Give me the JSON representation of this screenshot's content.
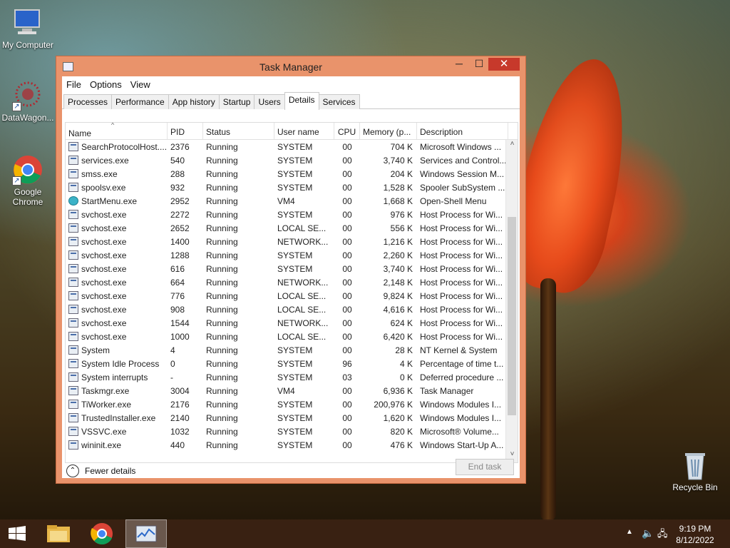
{
  "desktop": {
    "icons": [
      {
        "label": "My Computer",
        "icon": "computer-icon"
      },
      {
        "label": "DataWagon...",
        "icon": "datawagon-icon"
      },
      {
        "label": "Google Chrome",
        "icon": "chrome-icon"
      },
      {
        "label": "Recycle Bin",
        "icon": "recycle-bin-icon"
      }
    ]
  },
  "window": {
    "title": "Task Manager",
    "controls": {
      "minimize": "─",
      "maximize": "☐",
      "close": "✕"
    },
    "menu": [
      "File",
      "Options",
      "View"
    ],
    "tabs": [
      "Processes",
      "Performance",
      "App history",
      "Startup",
      "Users",
      "Details",
      "Services"
    ],
    "active_tab": "Details",
    "columns": [
      "Name",
      "PID",
      "Status",
      "User name",
      "CPU",
      "Memory (p...",
      "Description"
    ],
    "rows": [
      {
        "name": "SearchProtocolHost....",
        "pid": "2376",
        "status": "Running",
        "user": "SYSTEM",
        "cpu": "00",
        "mem": "704 K",
        "desc": "Microsoft Windows ..."
      },
      {
        "name": "services.exe",
        "pid": "540",
        "status": "Running",
        "user": "SYSTEM",
        "cpu": "00",
        "mem": "3,740 K",
        "desc": "Services and Control..."
      },
      {
        "name": "smss.exe",
        "pid": "288",
        "status": "Running",
        "user": "SYSTEM",
        "cpu": "00",
        "mem": "204 K",
        "desc": "Windows Session M..."
      },
      {
        "name": "spoolsv.exe",
        "pid": "932",
        "status": "Running",
        "user": "SYSTEM",
        "cpu": "00",
        "mem": "1,528 K",
        "desc": "Spooler SubSystem ..."
      },
      {
        "name": "StartMenu.exe",
        "pid": "2952",
        "status": "Running",
        "user": "VM4",
        "cpu": "00",
        "mem": "1,668 K",
        "desc": "Open-Shell Menu"
      },
      {
        "name": "svchost.exe",
        "pid": "2272",
        "status": "Running",
        "user": "SYSTEM",
        "cpu": "00",
        "mem": "976 K",
        "desc": "Host Process for Wi..."
      },
      {
        "name": "svchost.exe",
        "pid": "2652",
        "status": "Running",
        "user": "LOCAL SE...",
        "cpu": "00",
        "mem": "556 K",
        "desc": "Host Process for Wi..."
      },
      {
        "name": "svchost.exe",
        "pid": "1400",
        "status": "Running",
        "user": "NETWORK...",
        "cpu": "00",
        "mem": "1,216 K",
        "desc": "Host Process for Wi..."
      },
      {
        "name": "svchost.exe",
        "pid": "1288",
        "status": "Running",
        "user": "SYSTEM",
        "cpu": "00",
        "mem": "2,260 K",
        "desc": "Host Process for Wi..."
      },
      {
        "name": "svchost.exe",
        "pid": "616",
        "status": "Running",
        "user": "SYSTEM",
        "cpu": "00",
        "mem": "3,740 K",
        "desc": "Host Process for Wi..."
      },
      {
        "name": "svchost.exe",
        "pid": "664",
        "status": "Running",
        "user": "NETWORK...",
        "cpu": "00",
        "mem": "2,148 K",
        "desc": "Host Process for Wi..."
      },
      {
        "name": "svchost.exe",
        "pid": "776",
        "status": "Running",
        "user": "LOCAL SE...",
        "cpu": "00",
        "mem": "9,824 K",
        "desc": "Host Process for Wi..."
      },
      {
        "name": "svchost.exe",
        "pid": "908",
        "status": "Running",
        "user": "LOCAL SE...",
        "cpu": "00",
        "mem": "4,616 K",
        "desc": "Host Process for Wi..."
      },
      {
        "name": "svchost.exe",
        "pid": "1544",
        "status": "Running",
        "user": "NETWORK...",
        "cpu": "00",
        "mem": "624 K",
        "desc": "Host Process for Wi..."
      },
      {
        "name": "svchost.exe",
        "pid": "1000",
        "status": "Running",
        "user": "LOCAL SE...",
        "cpu": "00",
        "mem": "6,420 K",
        "desc": "Host Process for Wi..."
      },
      {
        "name": "System",
        "pid": "4",
        "status": "Running",
        "user": "SYSTEM",
        "cpu": "00",
        "mem": "28 K",
        "desc": "NT Kernel & System"
      },
      {
        "name": "System Idle Process",
        "pid": "0",
        "status": "Running",
        "user": "SYSTEM",
        "cpu": "96",
        "mem": "4 K",
        "desc": "Percentage of time t..."
      },
      {
        "name": "System interrupts",
        "pid": "-",
        "status": "Running",
        "user": "SYSTEM",
        "cpu": "03",
        "mem": "0 K",
        "desc": "Deferred procedure ..."
      },
      {
        "name": "Taskmgr.exe",
        "pid": "3004",
        "status": "Running",
        "user": "VM4",
        "cpu": "00",
        "mem": "6,936 K",
        "desc": "Task Manager"
      },
      {
        "name": "TiWorker.exe",
        "pid": "2176",
        "status": "Running",
        "user": "SYSTEM",
        "cpu": "00",
        "mem": "200,976 K",
        "desc": "Windows Modules I..."
      },
      {
        "name": "TrustedInstaller.exe",
        "pid": "2140",
        "status": "Running",
        "user": "SYSTEM",
        "cpu": "00",
        "mem": "1,620 K",
        "desc": "Windows Modules I..."
      },
      {
        "name": "VSSVC.exe",
        "pid": "1032",
        "status": "Running",
        "user": "SYSTEM",
        "cpu": "00",
        "mem": "820 K",
        "desc": "Microsoft® Volume..."
      },
      {
        "name": "wininit.exe",
        "pid": "440",
        "status": "Running",
        "user": "SYSTEM",
        "cpu": "00",
        "mem": "476 K",
        "desc": "Windows Start-Up A..."
      }
    ],
    "footer": {
      "fewer_details": "Fewer details",
      "end_task": "End task"
    }
  },
  "taskbar": {
    "items": [
      "start-icon",
      "file-explorer-icon",
      "chrome-icon",
      "task-manager-icon"
    ],
    "clock": {
      "time": "9:19 PM",
      "date": "8/12/2022"
    }
  }
}
